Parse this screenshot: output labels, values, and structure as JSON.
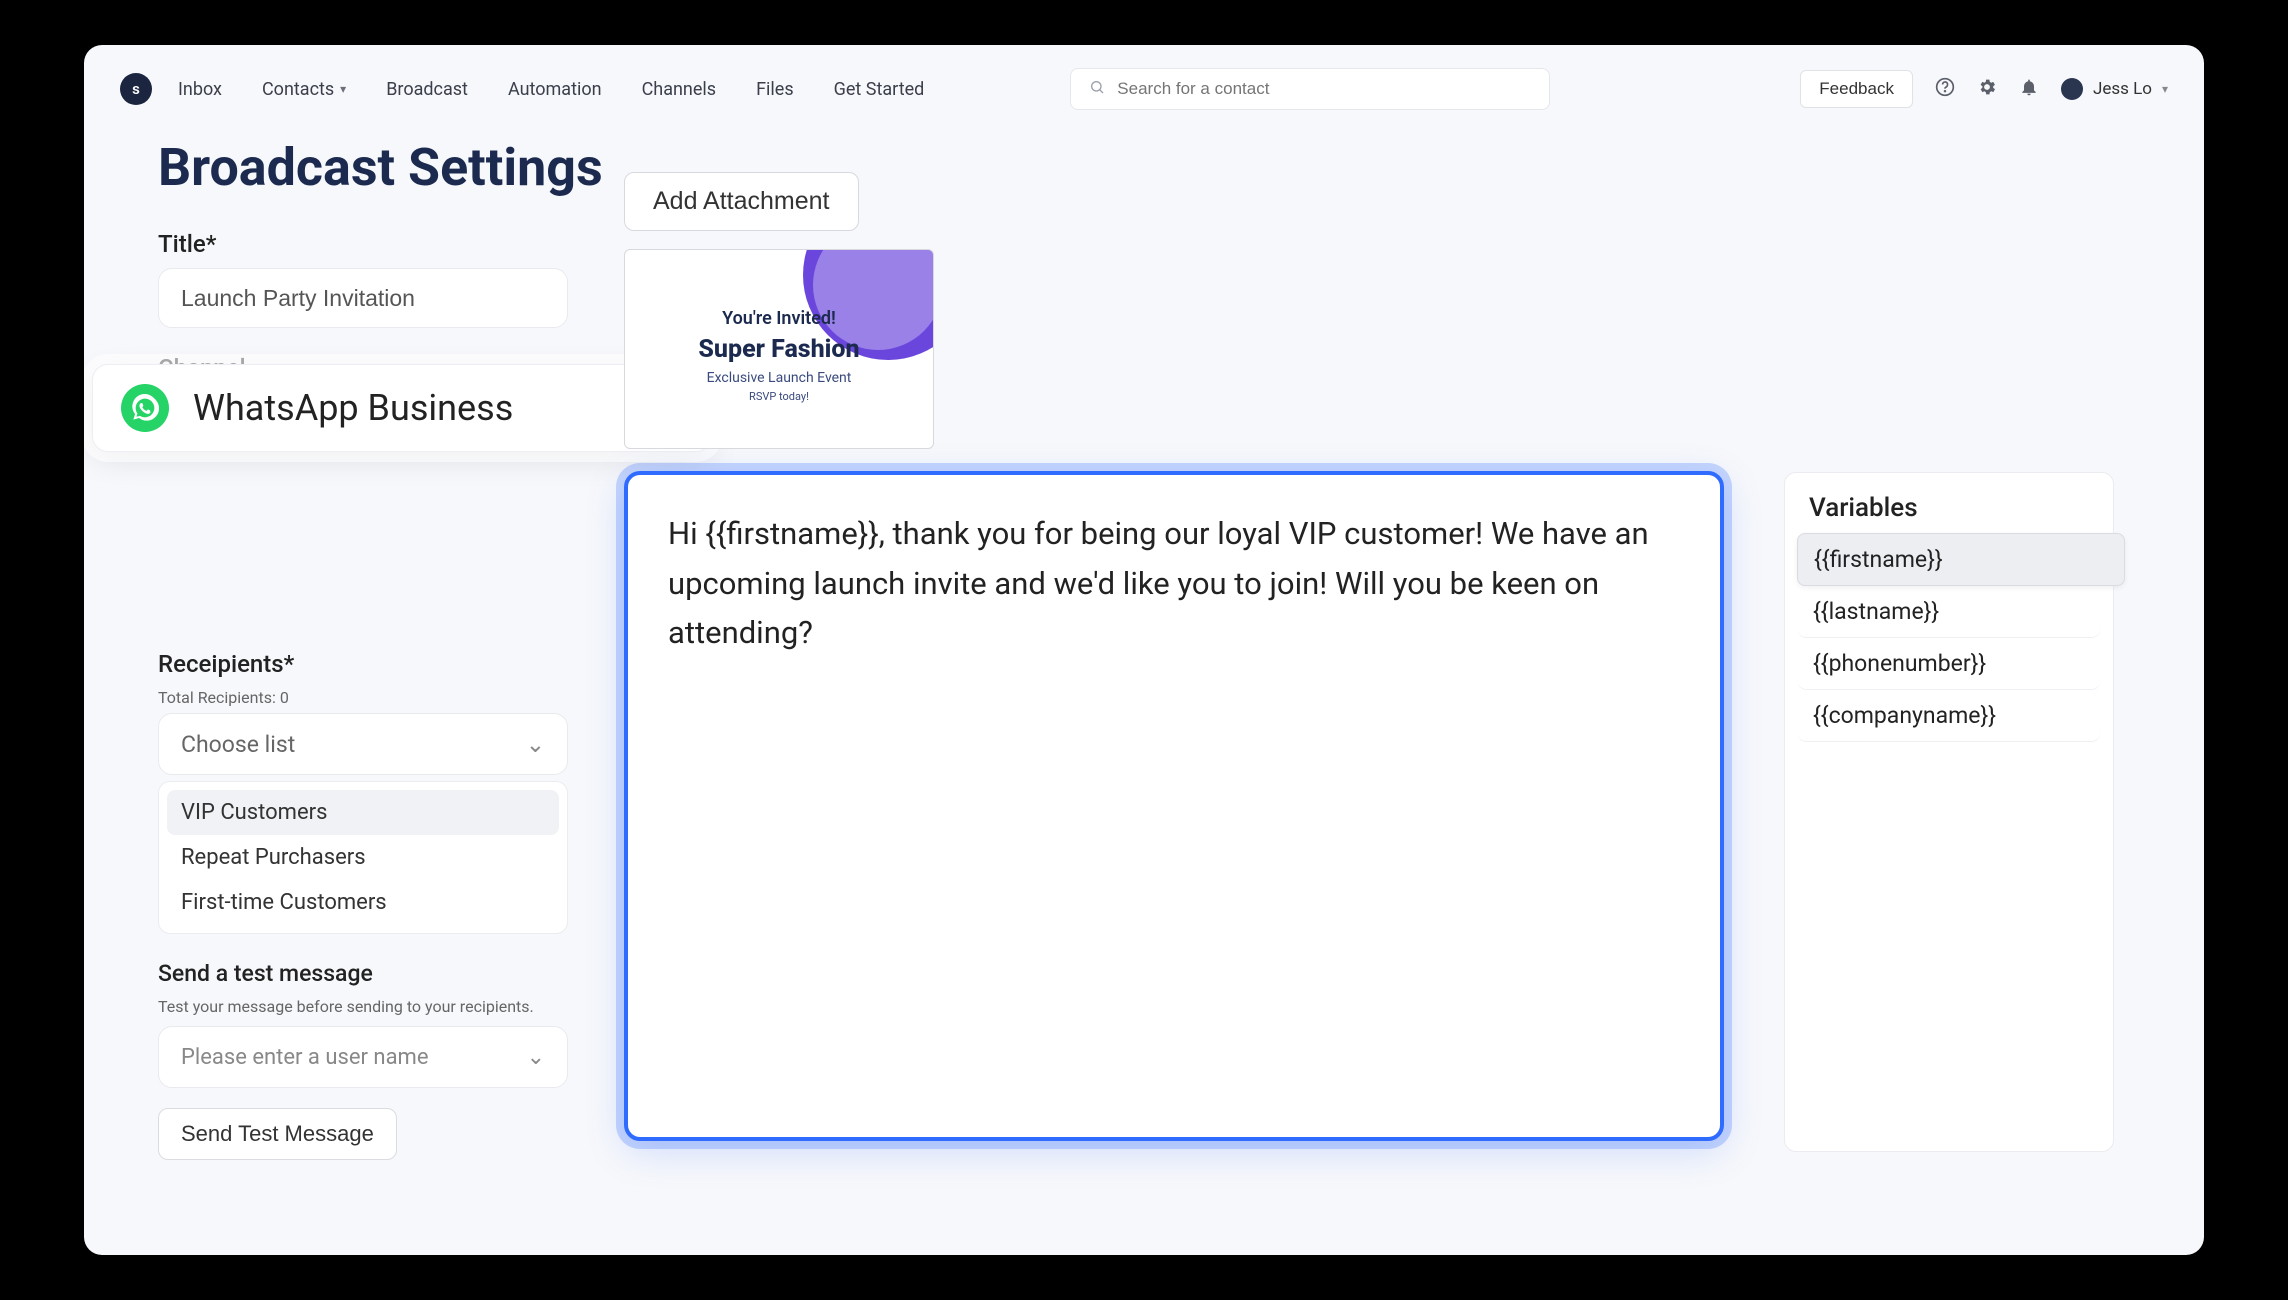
{
  "brand_letter": "s",
  "nav": {
    "inbox": "Inbox",
    "contacts": "Contacts",
    "broadcast": "Broadcast",
    "automation": "Automation",
    "channels": "Channels",
    "files": "Files",
    "get_started": "Get Started"
  },
  "search_placeholder": "Search for a contact",
  "feedback_label": "Feedback",
  "user_name": "Jess Lo",
  "page_title": "Broadcast Settings",
  "title_field": {
    "label": "Title*",
    "value": "Launch Party Invitation"
  },
  "channel_field": {
    "label": "Channel",
    "selected": "WhatsApp Business"
  },
  "recipients_field": {
    "label": "Receipients*",
    "sub": "Total Recipients: 0",
    "placeholder": "Choose list",
    "options": [
      "VIP Customers",
      "Repeat Purchasers",
      "First-time Customers"
    ],
    "selected_index": 0
  },
  "test_block": {
    "label": "Send a test message",
    "sub": "Test your message before sending to your recipients.",
    "placeholder": "Please enter a user name",
    "button": "Send Test Message"
  },
  "attachment": {
    "button": "Add Attachment",
    "line1": "You're Invited!",
    "line2": "Super Fashion",
    "line3": "Exclusive Launch Event",
    "line4": "RSVP today!"
  },
  "message_body": "Hi {{firstname}}, thank you for being our loyal VIP customer! We have an upcoming launch invite and we'd like you to join! Will you be keen on attending?",
  "variables": {
    "title": "Variables",
    "items": [
      "{{firstname}}",
      "{{lastname}}",
      "{{phonenumber}}",
      "{{companyname}}"
    ],
    "highlight_index": 0
  }
}
